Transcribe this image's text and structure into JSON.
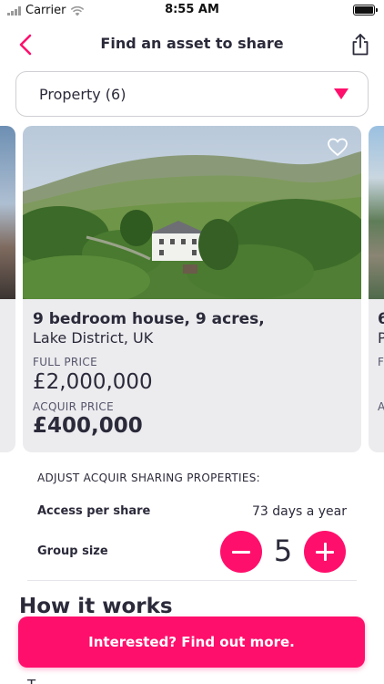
{
  "status_bar": {
    "carrier": "Carrier",
    "time": "8:55 AM",
    "signal_icon": "signal-icon",
    "wifi_icon": "wifi-icon",
    "battery_icon": "battery-icon"
  },
  "navbar": {
    "title": "Find an asset to share",
    "back_icon": "chevron-left-icon",
    "share_icon": "share-icon"
  },
  "filter": {
    "selected": "Property (6)",
    "caret_icon": "caret-down-icon"
  },
  "listing": {
    "title": "9 bedroom house, 9 acres,",
    "location": "Lake District, UK",
    "full_price_label": "FULL PRICE",
    "full_price": "£2,000,000",
    "acquir_price_label": "ACQUIR PRICE",
    "acquir_price": "£400,000",
    "favorite_icon": "heart-icon"
  },
  "next_listing": {
    "title_peek": "6",
    "location_peek": "P",
    "label1_peek": "F",
    "label2_peek": "A"
  },
  "sharing": {
    "title": "ADJUST ACQUIR SHARING PROPERTIES:",
    "access_label": "Access per share",
    "access_value": "73 days a year",
    "group_label": "Group size",
    "group_value": "5"
  },
  "how_it_works": {
    "heading": "How it works",
    "body_peek": "T"
  },
  "cta": {
    "label": "Interested? Find out more."
  },
  "colors": {
    "accent": "#ff0f6c",
    "text": "#2b2a3a",
    "card_bg": "#ececef"
  }
}
